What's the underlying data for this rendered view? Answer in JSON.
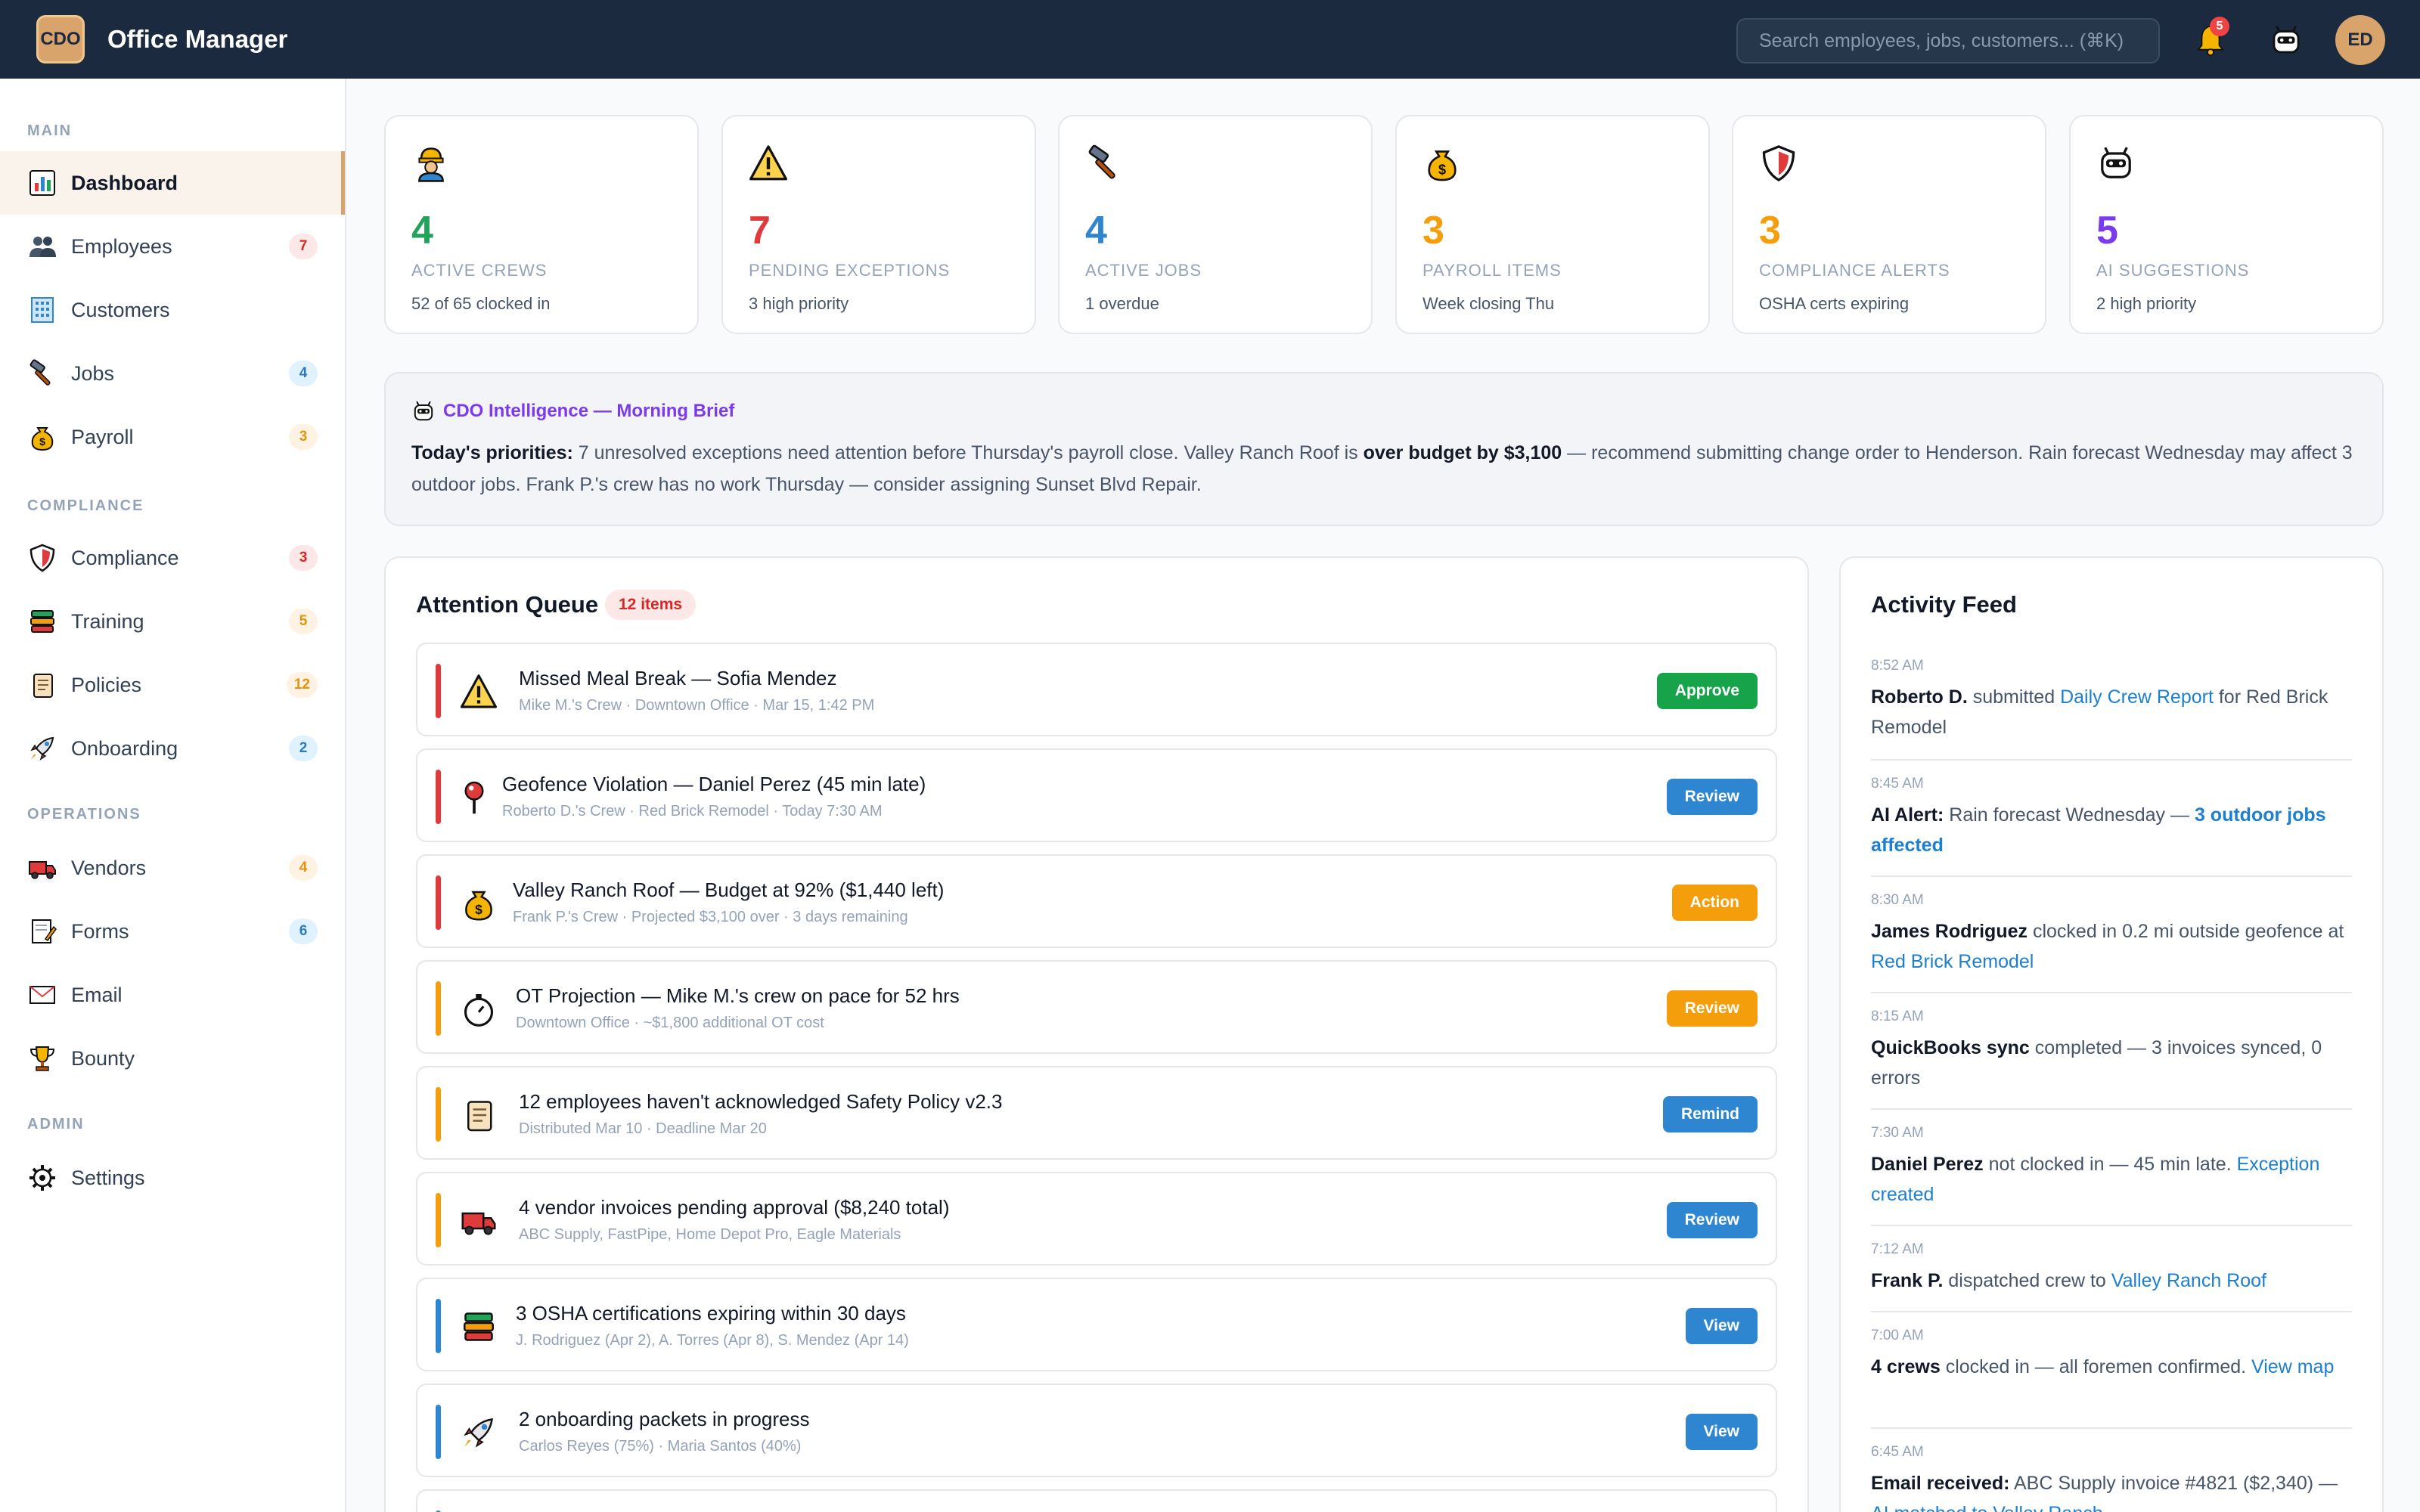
{
  "app": {
    "logo_text": "CDO",
    "title": "Office Manager"
  },
  "topbar": {
    "search_placeholder": "Search employees, jobs, customers... (⌘K)",
    "notif_count": "5",
    "avatar_initials": "ED"
  },
  "sidebar": {
    "sections": {
      "main": "MAIN",
      "compliance": "COMPLIANCE",
      "operations": "OPERATIONS",
      "admin": "ADMIN"
    },
    "items": [
      {
        "label": "Dashboard",
        "icon": "chart-icon",
        "badge": ""
      },
      {
        "label": "Employees",
        "icon": "people-icon",
        "badge": "7"
      },
      {
        "label": "Customers",
        "icon": "building-icon",
        "badge": ""
      },
      {
        "label": "Jobs",
        "icon": "hammer-icon",
        "badge": "4"
      },
      {
        "label": "Payroll",
        "icon": "money-bag-icon",
        "badge": "3"
      },
      {
        "label": "Compliance",
        "icon": "shield-icon",
        "badge": "3"
      },
      {
        "label": "Training",
        "icon": "books-icon",
        "badge": "5"
      },
      {
        "label": "Policies",
        "icon": "scroll-icon",
        "badge": "12"
      },
      {
        "label": "Onboarding",
        "icon": "rocket-icon",
        "badge": "2"
      },
      {
        "label": "Vendors",
        "icon": "truck-icon",
        "badge": "4"
      },
      {
        "label": "Forms",
        "icon": "memo-icon",
        "badge": "6"
      },
      {
        "label": "Email",
        "icon": "envelope-icon",
        "badge": ""
      },
      {
        "label": "Bounty",
        "icon": "trophy-icon",
        "badge": ""
      },
      {
        "label": "Settings",
        "icon": "gear-icon",
        "badge": ""
      }
    ]
  },
  "stats": [
    {
      "icon": "worker-icon",
      "value": "4",
      "label": "ACTIVE CREWS",
      "sub": "52 of 65 clocked in",
      "color": "#22a35a"
    },
    {
      "icon": "warning-icon",
      "value": "7",
      "label": "PENDING EXCEPTIONS",
      "sub": "3 high priority",
      "color": "#e03b3b"
    },
    {
      "icon": "hammer-icon",
      "value": "4",
      "label": "ACTIVE JOBS",
      "sub": "1 overdue",
      "color": "#2f86d0"
    },
    {
      "icon": "money-bag-icon",
      "value": "3",
      "label": "PAYROLL ITEMS",
      "sub": "Week closing Thu",
      "color": "#f59e0b"
    },
    {
      "icon": "shield-icon",
      "value": "3",
      "label": "COMPLIANCE ALERTS",
      "sub": "OSHA certs expiring",
      "color": "#f59e0b"
    },
    {
      "icon": "robot-icon",
      "value": "5",
      "label": "AI SUGGESTIONS",
      "sub": "2 high priority",
      "color": "#7c3aed"
    }
  ],
  "brief": {
    "title": "CDO Intelligence — Morning Brief",
    "lead": "Today's priorities:",
    "text1": " 7 unresolved exceptions need attention before Thursday's payroll close. Valley Ranch Roof is ",
    "bold": "over budget by $3,100",
    "text2": " — recommend submitting change order to Henderson. Rain forecast Wednesday may affect 3 outdoor jobs. Frank P.'s crew has no work Thursday — consider assigning Sunset Blvd Repair."
  },
  "queue": {
    "title": "Attention Queue",
    "count": "12 items",
    "items": [
      {
        "icon": "warning-icon",
        "title": "Missed Meal Break — Sofia Mendez",
        "sub": "Mike M.'s Crew · Downtown Office · Mar 15, 1:42 PM",
        "button": "Approve",
        "bar": "#e03b3b",
        "btn": "green"
      },
      {
        "icon": "pin-icon",
        "title": "Geofence Violation — Daniel Perez (45 min late)",
        "sub": "Roberto D.'s Crew · Red Brick Remodel · Today 7:30 AM",
        "button": "Review",
        "bar": "#e03b3b",
        "btn": "blue"
      },
      {
        "icon": "money-bag-icon",
        "title": "Valley Ranch Roof — Budget at 92% ($1,440 left)",
        "sub": "Frank P.'s Crew · Projected $3,100 over · 3 days remaining",
        "button": "Action",
        "bar": "#e03b3b",
        "btn": "orange"
      },
      {
        "icon": "stopwatch-icon",
        "title": "OT Projection — Mike M.'s crew on pace for 52 hrs",
        "sub": "Downtown Office · ~$1,800 additional OT cost",
        "button": "Review",
        "bar": "#f59e0b",
        "btn": "orange"
      },
      {
        "icon": "scroll-icon",
        "title": "12 employees haven't acknowledged Safety Policy v2.3",
        "sub": "Distributed Mar 10 · Deadline Mar 20",
        "button": "Remind",
        "bar": "#f59e0b",
        "btn": "blue"
      },
      {
        "icon": "truck-icon",
        "title": "4 vendor invoices pending approval ($8,240 total)",
        "sub": "ABC Supply, FastPipe, Home Depot Pro, Eagle Materials",
        "button": "Review",
        "bar": "#f59e0b",
        "btn": "blue"
      },
      {
        "icon": "books-icon",
        "title": "3 OSHA certifications expiring within 30 days",
        "sub": "J. Rodriguez (Apr 2), A. Torres (Apr 8), S. Mendez (Apr 14)",
        "button": "View",
        "bar": "#2f86d0",
        "btn": "blue"
      },
      {
        "icon": "rocket-icon",
        "title": "2 onboarding packets in progress",
        "sub": "Carlos Reyes (75%) · Maria Santos (40%)",
        "button": "View",
        "bar": "#2f86d0",
        "btn": "blue"
      }
    ]
  },
  "feed": {
    "title": "Activity Feed",
    "items": [
      {
        "time": "8:52 AM",
        "bold": "Roberto D.",
        "text": " submitted ",
        "link": "Daily Crew Report",
        "tail": " for Red Brick Remodel"
      },
      {
        "time": "8:45 AM",
        "bold": "AI Alert:",
        "text": " Rain forecast Wednesday — ",
        "link": "3 outdoor jobs affected",
        "tail": ""
      },
      {
        "time": "8:30 AM",
        "bold": "James Rodriguez",
        "text": " clocked in 0.2 mi outside geofence at ",
        "link": "Red Brick Remodel",
        "tail": ""
      },
      {
        "time": "8:15 AM",
        "bold": "QuickBooks sync",
        "text": " completed — 3 invoices synced, 0 errors",
        "link": "",
        "tail": ""
      },
      {
        "time": "7:30 AM",
        "bold": "Daniel Perez",
        "text": " not clocked in — 45 min late. ",
        "link": "Exception created",
        "tail": ""
      },
      {
        "time": "7:12 AM",
        "bold": "Frank P.",
        "text": " dispatched crew to ",
        "link": "Valley Ranch Roof",
        "tail": ""
      },
      {
        "time": "7:00 AM",
        "bold": "4 crews",
        "text": " clocked in — all foremen confirmed. ",
        "link": "View map",
        "tail": ""
      },
      {
        "time": "6:45 AM",
        "bold": "Email received:",
        "text": " ABC Supply invoice #4821 ($2,340) — ",
        "link": "AI matched to Valley Ranch",
        "tail": ""
      }
    ]
  }
}
